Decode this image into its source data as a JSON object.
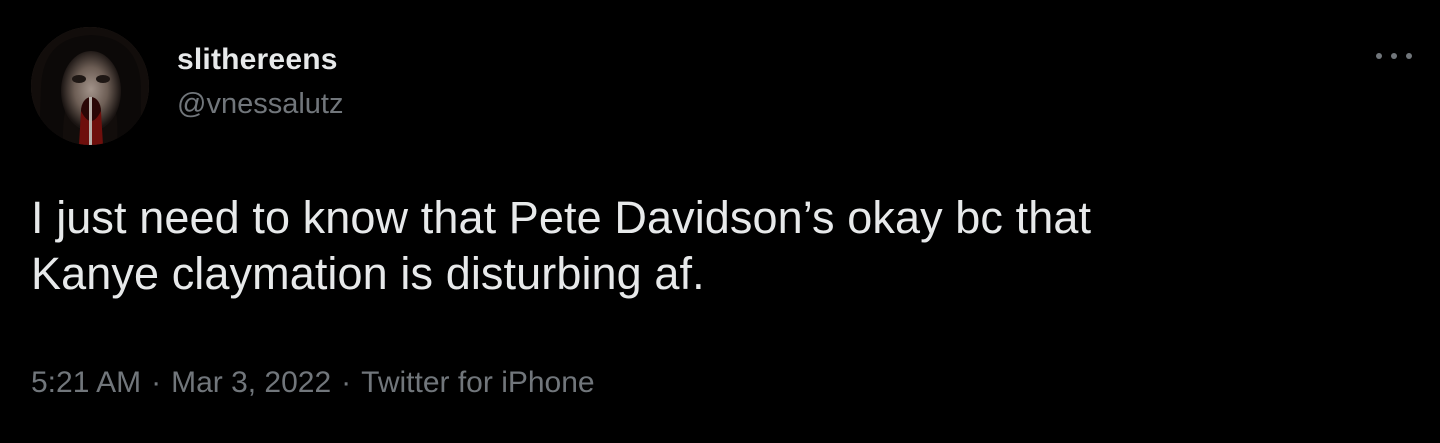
{
  "tweet": {
    "author": {
      "display_name": "slithereens",
      "handle": "@vnessalutz",
      "avatar": "profile-photo"
    },
    "more_icon": "more-horizontal-icon",
    "text_lines": [
      "I just need to know that Pete Davidson’s okay bc that",
      "Kanye claymation is disturbing af."
    ],
    "meta": {
      "time": "5:21 AM",
      "separator": "·",
      "date": "Mar 3, 2022",
      "source": "Twitter for iPhone"
    }
  },
  "colors": {
    "background": "#000000",
    "primary_text": "#e7e9ea",
    "secondary_text": "#71767b"
  }
}
